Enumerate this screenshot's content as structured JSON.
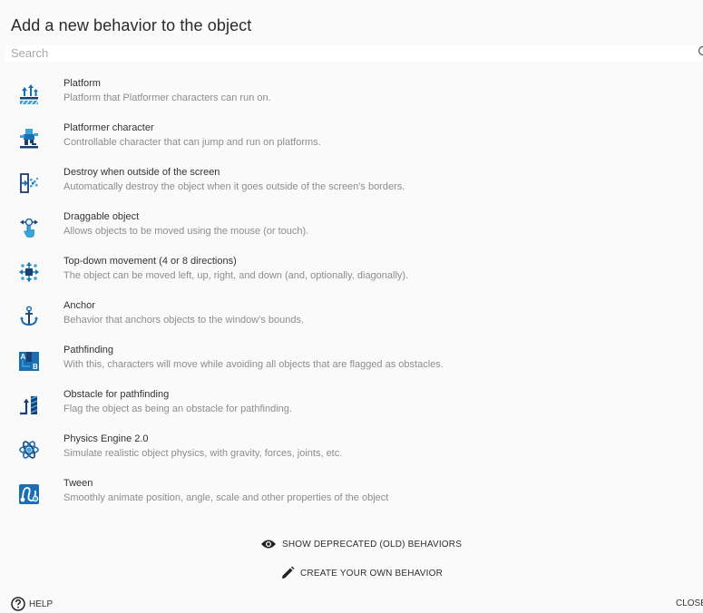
{
  "dialog": {
    "title": "Add a new behavior to the object",
    "search": {
      "placeholder": "Search",
      "value": ""
    }
  },
  "behaviors": [
    {
      "name": "Platform",
      "description": "Platform that Platformer characters can run on.",
      "icon": "platform-icon"
    },
    {
      "name": "Platformer character",
      "description": "Controllable character that can jump and run on platforms.",
      "icon": "platformer-character-icon"
    },
    {
      "name": "Destroy when outside of the screen",
      "description": "Automatically destroy the object when it goes outside of the screen's borders.",
      "icon": "destroy-outside-icon"
    },
    {
      "name": "Draggable object",
      "description": "Allows objects to be moved using the mouse (or touch).",
      "icon": "draggable-icon"
    },
    {
      "name": "Top-down movement (4 or 8 directions)",
      "description": "The object can be moved left, up, right, and down (and, optionally, diagonally).",
      "icon": "topdown-movement-icon"
    },
    {
      "name": "Anchor",
      "description": "Behavior that anchors objects to the window's bounds.",
      "icon": "anchor-icon"
    },
    {
      "name": "Pathfinding",
      "description": "With this, characters will move while avoiding all objects that are flagged as obstacles.",
      "icon": "pathfinding-icon"
    },
    {
      "name": "Obstacle for pathfinding",
      "description": "Flag the object as being an obstacle for pathfinding.",
      "icon": "obstacle-icon"
    },
    {
      "name": "Physics Engine 2.0",
      "description": "Simulate realistic object physics, with gravity, forces, joints, etc.",
      "icon": "physics-icon"
    },
    {
      "name": "Tween",
      "description": "Smoothly animate position, angle, scale and other properties of the object",
      "icon": "tween-icon"
    }
  ],
  "actions": {
    "show_deprecated": "SHOW DEPRECATED (OLD) BEHAVIORS",
    "create_own": "CREATE YOUR OWN BEHAVIOR",
    "help": "HELP",
    "close": "CLOSE"
  },
  "colors": {
    "icon_blue": "#1a6fb4",
    "icon_dark": "#1b3f73",
    "icon_light": "#3aa3d8"
  }
}
